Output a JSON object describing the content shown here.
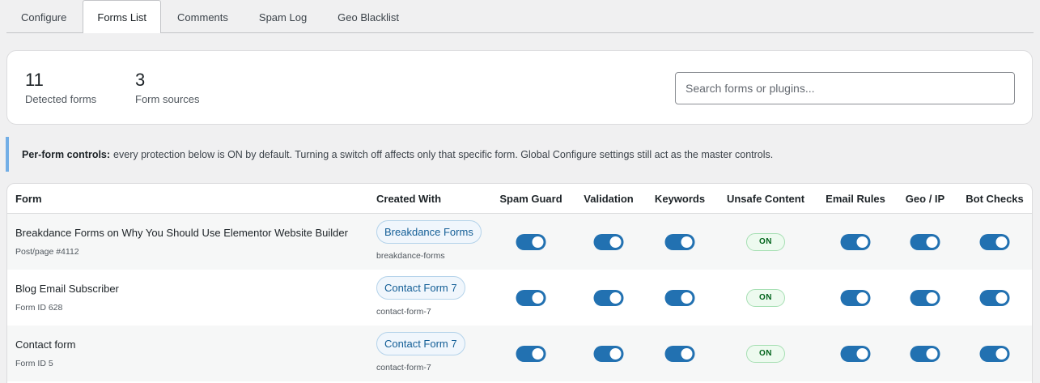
{
  "tabs": [
    {
      "label": "Configure"
    },
    {
      "label": "Forms List"
    },
    {
      "label": "Comments"
    },
    {
      "label": "Spam Log"
    },
    {
      "label": "Geo Blacklist"
    }
  ],
  "active_tab": "Forms List",
  "stats": {
    "detected": {
      "value": "11",
      "label": "Detected forms"
    },
    "sources": {
      "value": "3",
      "label": "Form sources"
    }
  },
  "search": {
    "placeholder": "Search forms or plugins...",
    "value": ""
  },
  "notice": {
    "bold": "Per-form controls:",
    "text": "every protection below is ON by default. Turning a switch off affects only that specific form. Global Configure settings still act as the master controls."
  },
  "table": {
    "headers": {
      "form": "Form",
      "created_with": "Created With",
      "spam_guard": "Spam Guard",
      "validation": "Validation",
      "keywords": "Keywords",
      "unsafe_content": "Unsafe Content",
      "email_rules": "Email Rules",
      "geo_ip": "Geo / IP",
      "bot_checks": "Bot Checks"
    },
    "rows": [
      {
        "title": "Breakdance Forms on Why You Should Use Elementor Website Builder",
        "sub": "Post/page #4112",
        "plugin": "Breakdance Forms",
        "slug": "breakdance-forms",
        "unsafe_label": "ON"
      },
      {
        "title": "Blog Email Subscriber",
        "sub": "Form ID 628",
        "plugin": "Contact Form 7",
        "slug": "contact-form-7",
        "unsafe_label": "ON"
      },
      {
        "title": "Contact form",
        "sub": "Form ID 5",
        "plugin": "Contact Form 7",
        "slug": "contact-form-7",
        "unsafe_label": "ON"
      }
    ]
  },
  "colors": {
    "accent": "#2271b1",
    "notice_border": "#72aee6",
    "on_badge_bg": "#edfaef",
    "on_badge_text": "#00631a"
  }
}
